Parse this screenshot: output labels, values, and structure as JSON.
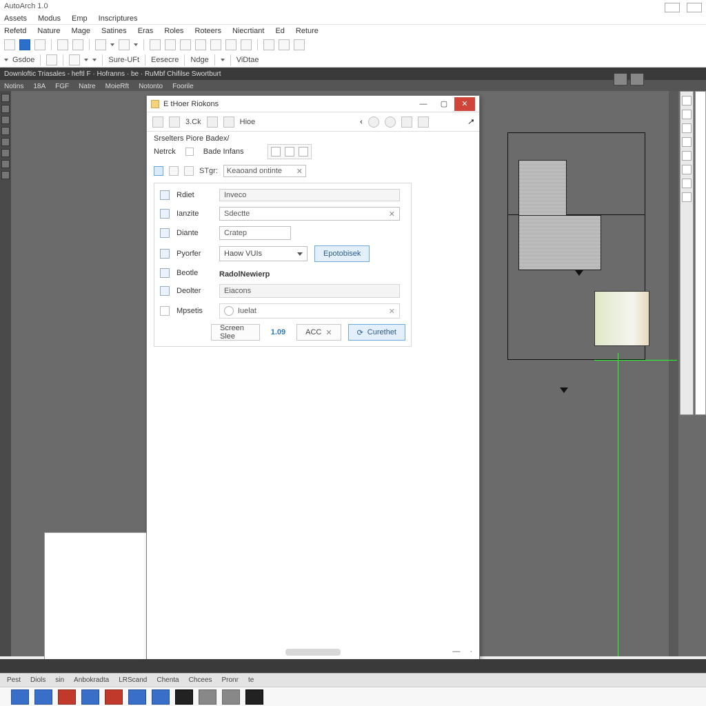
{
  "app": {
    "title": "AutoArch 1.0"
  },
  "menu1": [
    "Assets",
    "Modus",
    "Emp",
    "Inscriptures"
  ],
  "menu2": [
    "Refetd",
    "Nature",
    "Mage",
    "Satines",
    "Eras",
    "Roles",
    "Roteers",
    "Niecrtiant",
    "Ed",
    "Reture"
  ],
  "toolbar2": {
    "gsdoe": "Gsdoe",
    "sureuft": "Sure-UFt",
    "esecre": "Eesecre",
    "ndge": "Ndge",
    "vidtae": "ViDtae"
  },
  "darkStrip": "Downloftic Triasales - heftl F · Hofranns · be · RuMbf Chifilse Swortburt",
  "darkTabs": [
    "Notins",
    "18A",
    "FGF",
    "Natre",
    "MoieRft",
    "Notonto",
    "Foorile"
  ],
  "dialog": {
    "title": "E tHoer Riokons",
    "tool_label1": "3.Ck",
    "tool_label2": "Hioe",
    "subTitle": "Srselters Piore Badex/",
    "subRow1": "Netrck",
    "subRow2": "Bade Infans",
    "filterLabel": "STgr:",
    "filterValue": "Keaoand ontinte",
    "rows": {
      "r1": "Rdiet",
      "r2": "Ianzite",
      "r3": "Diante",
      "r4": "Pyorfer",
      "r5": "Beotle",
      "r6": "Deolter",
      "r7": "Mpsetis"
    },
    "head": "Inveco",
    "input1": "Sdectte",
    "input2": "Cratep",
    "selectVal": "Haow VUIs",
    "primaryBtn": "Epotobisek",
    "section": "RadolNewierp",
    "bar": "Eiacons",
    "option": "Iuelat",
    "btnScreen": "Screen Slee",
    "btnNum": "1.09",
    "btnAcc": "ACC",
    "btnConsider": "Curethet"
  },
  "sheets": [
    "Pest",
    "Diols",
    "sin",
    "Anbokradta",
    "LRScand",
    "Chenta",
    "Chcees",
    "Pronr",
    "te"
  ],
  "taskbarLabels": [
    "",
    "",
    "",
    "",
    "",
    "",
    "",
    "",
    "",
    ""
  ]
}
